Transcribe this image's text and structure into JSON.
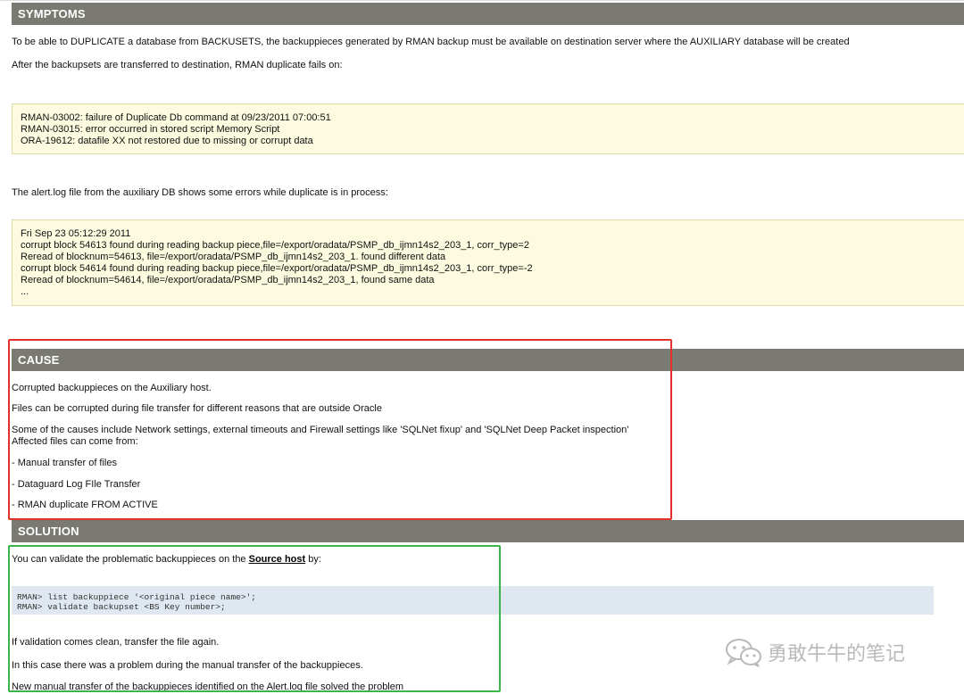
{
  "symptoms": {
    "header": "SYMPTOMS",
    "p1": "To be able to DUPLICATE a database from BACKUSETS, the backuppieces generated by RMAN backup must be available on destination server where the AUXILIARY database will be created",
    "p2": "After the backupsets are transferred to destination, RMAN duplicate fails on:",
    "error_lines": [
      "RMAN-03002: failure of Duplicate Db command at 09/23/2011 07:00:51",
      "RMAN-03015: error occurred in stored script Memory Script",
      "ORA-19612: datafile XX not restored due to missing or corrupt data"
    ],
    "p3": "The alert.log file from the auxiliary DB shows some errors while duplicate is in process:",
    "alert_lines": [
      "Fri Sep 23 05:12:29 2011",
      "corrupt block 54613 found during reading backup piece,file=/export/oradata/PSMP_db_ijmn14s2_203_1, corr_type=2",
      "Reread of blocknum=54613, file=/export/oradata/PSMP_db_ijmn14s2_203_1. found different data",
      "corrupt block 54614 found during reading backup piece,file=/export/oradata/PSMP_db_ijmn14s2_203_1, corr_type=-2",
      "Reread of blocknum=54614, file=/export/oradata/PSMP_db_ijmn14s2_203_1, found same data",
      "..."
    ]
  },
  "cause": {
    "header": "CAUSE",
    "p1": "Corrupted backuppieces on the Auxiliary host.",
    "p2": "Files can be corrupted during file transfer for different reasons that are outside Oracle",
    "p3a": "Some of the causes include Network settings, external timeouts and Firewall settings like 'SQLNet fixup' and 'SQLNet Deep Packet inspection'",
    "p3b": "Affected files can come from:",
    "items": [
      "- Manual transfer of files",
      "- Dataguard Log FIle Transfer",
      "- RMAN duplicate FROM ACTIVE"
    ]
  },
  "solution": {
    "header": "SOLUTION",
    "p1_pre": "You can validate the problematic backuppieces on the ",
    "p1_link": "Source host",
    "p1_post": " by:",
    "code_lines": [
      "RMAN> list backuppiece '<original piece name>';",
      "RMAN> validate backupset <BS Key number>;"
    ],
    "p2": "If validation comes clean, transfer the file again.",
    "p3": "In this case there was a problem during the manual transfer of the backuppieces.",
    "p4": "New manual transfer of the backuppieces identified on the Alert.log file solved the problem"
  },
  "watermark": {
    "text": "勇敢牛牛的笔记",
    "icon": "wechat-icon"
  },
  "colors": {
    "header_bg": "#7a7a72",
    "note_bg": "#fdfbdf",
    "code_bg": "#dfe8f0",
    "highlight_red": "#e5312b",
    "highlight_green": "#3bb54a"
  }
}
